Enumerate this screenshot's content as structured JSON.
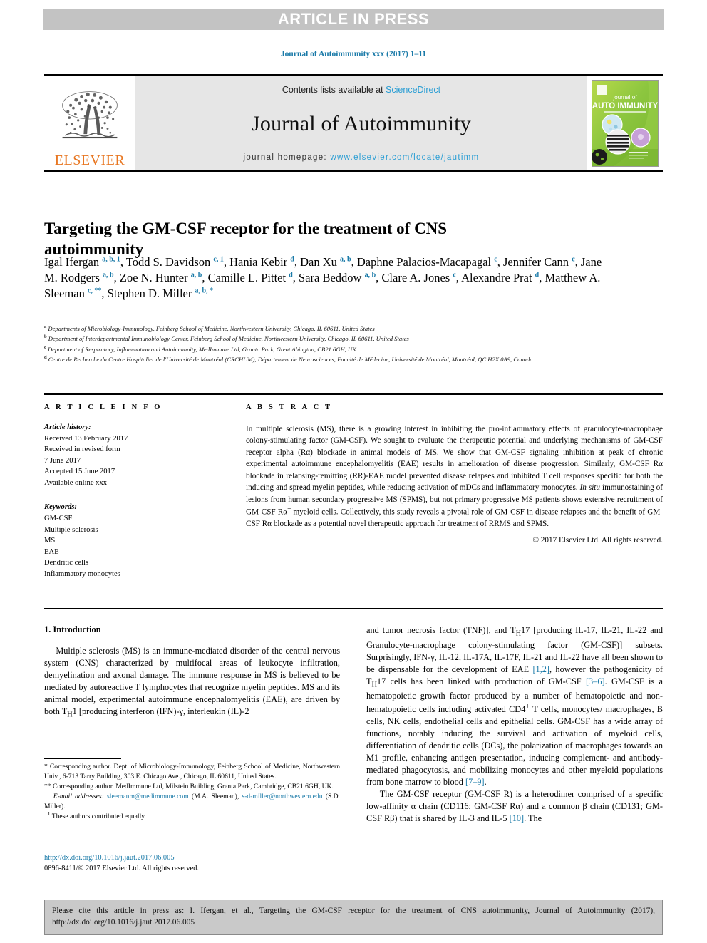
{
  "banner": {
    "text": "ARTICLE IN PRESS"
  },
  "journal_ref": "Journal of Autoimmunity xxx (2017) 1–11",
  "masthead": {
    "publisher": "ELSEVIER",
    "contents_prefix": "Contents lists available at ",
    "contents_link": "ScienceDirect",
    "journal_name": "Journal of Autoimmunity",
    "homepage_prefix": "journal homepage: ",
    "homepage_url": "www.elsevier.com/locate/jautimm",
    "cover_line1": "journal of",
    "cover_line2": "AUTO IMMUNITY"
  },
  "title": "Targeting the GM-CSF receptor for the treatment of CNS autoimmunity",
  "authors_html": "Igal Ifergan <sup>a, b, 1</sup>, Todd S. Davidson <sup>c, 1</sup>, Hania Kebir <sup>d</sup>, Dan Xu <sup>a, b</sup>, Daphne Palacios-Macapagal <sup>c</sup>, Jennifer Cann <sup>c</sup>, Jane M. Rodgers <sup>a, b</sup>, Zoe N. Hunter <sup>a, b</sup>, Camille L. Pittet <sup>d</sup>, Sara Beddow <sup>a, b</sup>, Clare A. Jones <sup>c</sup>, Alexandre Prat <sup>d</sup>, Matthew A. Sleeman <sup>c, **</sup>, Stephen D. Miller <sup>a, b, *</sup>",
  "affiliations": [
    {
      "mark": "a",
      "text": "Departments of Microbiology-Immunology, Feinberg School of Medicine, Northwestern University, Chicago, IL 60611, United States"
    },
    {
      "mark": "b",
      "text": "Department of Interdepartmental Immunobiology Center, Feinberg School of Medicine, Northwestern University, Chicago, IL 60611, United States"
    },
    {
      "mark": "c",
      "text": "Department of Respiratory, Inflammation and Autoimmunity, MedImmune Ltd, Granta Park, Great Abington, CB21 6GH, UK"
    },
    {
      "mark": "d",
      "text": "Centre de Recherche du Centre Hospitalier de l'Université de Montréal (CRCHUM), Département de Neurosciences, Faculté de Médecine, Université de Montréal, Montréal, QC H2X 0A9, Canada"
    }
  ],
  "article_info": {
    "heading": "A R T I C L E   I N F O",
    "history_label": "Article history:",
    "history_lines": [
      "Received 13 February 2017",
      "Received in revised form",
      "7 June 2017",
      "Accepted 15 June 2017",
      "Available online xxx"
    ],
    "keywords_label": "Keywords:",
    "keywords": [
      "GM-CSF",
      "Multiple sclerosis",
      "MS",
      "EAE",
      "Dendritic cells",
      "Inflammatory monocytes"
    ]
  },
  "abstract": {
    "heading": "A B S T R A C T",
    "text": "In multiple sclerosis (MS), there is a growing interest in inhibiting the pro-inflammatory effects of granulocyte-macrophage colony-stimulating factor (GM-CSF). We sought to evaluate the therapeutic potential and underlying mechanisms of GM-CSF receptor alpha (Rα) blockade in animal models of MS. We show that GM-CSF signaling inhibition at peak of chronic experimental autoimmune encephalomyelitis (EAE) results in amelioration of disease progression. Similarly, GM-CSF Rα blockade in relapsing-remitting (RR)-EAE model prevented disease relapses and inhibited T cell responses specific for both the inducing and spread myelin peptides, while reducing activation of mDCs and inflammatory monocytes. In situ immunostaining of lesions from human secondary progressive MS (SPMS), but not primary progressive MS patients shows extensive recruitment of GM-CSF Rα+ myeloid cells. Collectively, this study reveals a pivotal role of GM-CSF in disease relapses and the benefit of GM-CSF Rα blockade as a potential novel therapeutic approach for treatment of RRMS and SPMS.",
    "copyright": "© 2017 Elsevier Ltd. All rights reserved."
  },
  "introduction": {
    "heading": "1.  Introduction",
    "para1": "Multiple sclerosis (MS) is an immune-mediated disorder of the central nervous system (CNS) characterized by multifocal areas of leukocyte infiltration, demyelination and axonal damage. The immune response in MS is believed to be mediated by autoreactive T lymphocytes that recognize myelin peptides. MS and its animal model, experimental autoimmune encephalomyelitis (EAE), are driven by both T<sub>H</sub>1 [producing interferon (IFN)-γ, interleukin (IL)-2 and tumor necrosis factor (TNF)], and T<sub>H</sub>17 [producing IL-17, IL-21, IL-22 and Granulocyte-macrophage colony-stimulating factor (GM-CSF)] subsets. Surprisingly, IFN-γ, IL-12, IL-17A, IL-17F, IL-21 and IL-22 have all been shown to be dispensable for the development of EAE [1,2], however the pathogenicity of T<sub>H</sub>17 cells has been linked with production of GM-CSF [3–6]. GM-CSF is a hematopoietic growth factor produced by a number of hematopoietic and non-hematopoietic cells including activated CD4<sup>+</sup> T cells, monocytes/macrophages, B cells, NK cells, endothelial cells and epithelial cells. GM-CSF has a wide array of functions, notably inducing the survival and activation of myeloid cells, differentiation of dendritic cells (DCs), the polarization of macrophages towards an M1 profile, enhancing antigen presentation, inducing complement- and antibody-mediated phagocytosis, and mobilizing monocytes and other myeloid populations from bone marrow to blood [7–9].",
    "para2": "The GM-CSF receptor (GM-CSF R) is a heterodimer comprised of a specific low-affinity α chain (CD116; GM-CSF Rα) and a common β chain (CD131; GM-CSF Rβ) that is shared by IL-3 and IL-5 [10]. The",
    "left_col_html": "&nbsp;&nbsp;&nbsp;&nbsp;Multiple sclerosis (MS) is an immune-mediated disorder of the central nervous system (CNS) characterized by multifocal areas of leukocyte infiltration, demyelination and axonal damage. The immune response in MS is believed to be mediated by autoreactive T lymphocytes that recognize myelin peptides. MS and its animal model, experimental autoimmune encephalomyelitis (EAE), are driven by both T<sub>H</sub>1 [producing interferon (IFN)-γ, interleukin (IL)-2",
    "right_col_html": "and tumor necrosis factor (TNF)], and T<sub>H</sub>17 [producing IL-17, IL-21, IL-22 and Granulocyte-macrophage colony-stimulating factor (GM-CSF)] subsets. Surprisingly, IFN-γ, IL-12, IL-17A, IL-17F, IL-21 and IL-22 have all been shown to be dispensable for the development of EAE <span class=\"ref-link\">[1,2]</span>, however the pathogenicity of T<sub>H</sub>17 cells has been linked with production of GM-CSF <span class=\"ref-link\">[3–6]</span>. GM-CSF is a hematopoietic growth factor produced by a number of hematopoietic and non-hematopoietic cells including activated CD4<sup>+</sup> T cells, monocytes/ macrophages, B cells, NK cells, endothelial cells and epithelial cells. GM-CSF has a wide array of functions, notably inducing the survival and activation of myeloid cells, differentiation of dendritic cells (DCs), the polarization of macrophages towards an M1 profile, enhancing antigen presentation, inducing complement- and antibody-mediated phagocytosis, and mobilizing monocytes and other myeloid populations from bone marrow to blood <span class=\"ref-link\">[7–9]</span>.",
    "right_col_para2_html": "&nbsp;&nbsp;&nbsp;&nbsp;The GM-CSF receptor (GM-CSF R) is a heterodimer comprised of a specific low-affinity α chain (CD116; GM-CSF Rα) and a common β chain (CD131; GM-CSF Rβ) that is shared by IL-3 and IL-5 <span class=\"ref-link\">[10]</span>. The"
  },
  "footnotes": {
    "corr1": "* Corresponding author. Dept. of Microbiology-Immunology, Feinberg School of Medicine, Northwestern Univ., 6-713 Tarry Building, 303 E. Chicago Ave., Chicago, IL 60611, United States.",
    "corr2": "** Corresponding author. MedImmune Ltd, Milstein Building, Granta Park, Cambridge, CB21 6GH, UK.",
    "email_label": "E-mail addresses:",
    "email1": "sleemanm@medimmune.com",
    "email1_owner": "(M.A. Sleeman),",
    "email2": "s-d-miller@northwestern.edu",
    "email2_owner": "(S.D. Miller).",
    "equal_contrib": "These authors contributed equally.",
    "equal_contrib_mark": "1"
  },
  "bottom": {
    "doi": "http://dx.doi.org/10.1016/j.jaut.2017.06.005",
    "issn": "0896-8411/© 2017 Elsevier Ltd. All rights reserved."
  },
  "cite_box": {
    "text": "Please cite this article in press as: I. Ifergan, et al., Targeting the GM-CSF receptor for the treatment of CNS autoimmunity, Journal of Autoimmunity (2017), http://dx.doi.org/10.1016/j.jaut.2017.06.005"
  },
  "colors": {
    "link": "#1a7aa8",
    "sd_link": "#2b9ed4",
    "elsevier_orange": "#e87722",
    "banner_bg": "#c3c3c3",
    "masthead_bg": "#e6e6e6",
    "cite_bg": "#c9c9c9"
  }
}
